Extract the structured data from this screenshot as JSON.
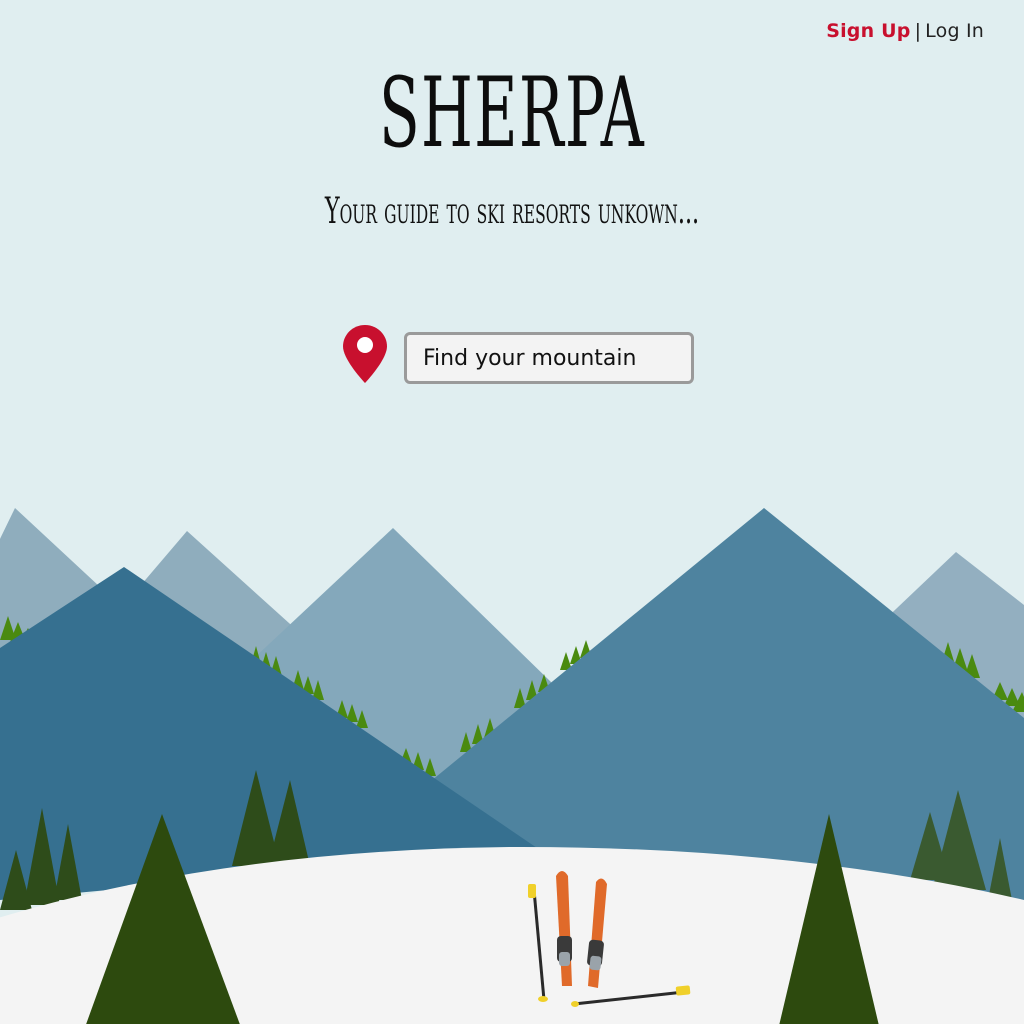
{
  "auth": {
    "signup_label": "Sign Up",
    "separator": "|",
    "login_label": "Log In"
  },
  "brand": {
    "title": "SHERPA",
    "tagline": "Your guide to ski resorts unkown..."
  },
  "search": {
    "placeholder": "Find your mountain",
    "icon": "map-pin-icon"
  },
  "colors": {
    "sky": "#e0eef0",
    "accent_red": "#c8102e",
    "snow": "#f4f4f4",
    "mountain_far": "#8fadbd",
    "mountain_mid": "#84a8bb",
    "mountain_front_left": "#367090",
    "mountain_front_right": "#4e839f",
    "tree_dark": "#2d4a0e",
    "tree_bright": "#4a8a10",
    "ski_orange": "#e06a2a",
    "pole_yellow": "#f0d02a"
  },
  "scene": {
    "illustration": "mountain landscape with skis and poles in snow",
    "icons": [
      "mountain-icon",
      "pine-tree-icon",
      "ski-icon",
      "ski-pole-icon"
    ]
  }
}
